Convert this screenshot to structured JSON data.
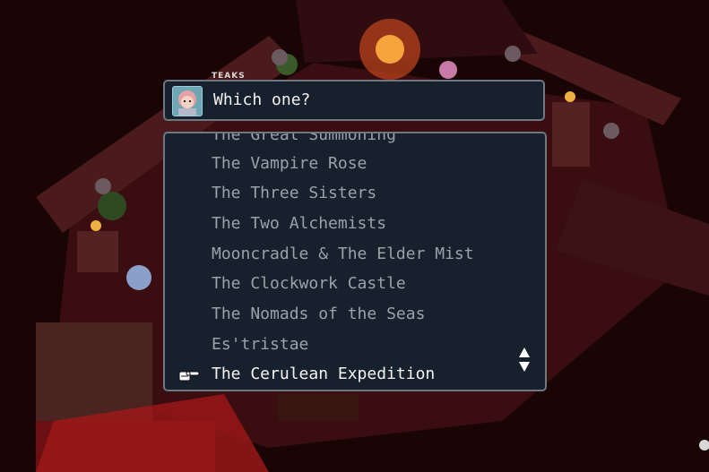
{
  "dialog": {
    "speaker": "TEAKS",
    "text": "Which one?"
  },
  "menu": {
    "items": [
      "The Great Summoning",
      "The Vampire Rose",
      "The Three Sisters",
      "The Two Alchemists",
      "Mooncradle & The Elder Mist",
      "The Clockwork Castle",
      "The Nomads of the Seas",
      "Es'tristae",
      "The Cerulean Expedition"
    ],
    "selected_index": 8
  },
  "icons": {
    "pointer": "pointing-hand-icon",
    "scroll": "scroll-up-down-icon"
  },
  "colors": {
    "panel_bg": "#17212e",
    "panel_border": "#6e7883",
    "item_text": "#9aa1a8",
    "selected_text": "#f3f3f3"
  }
}
